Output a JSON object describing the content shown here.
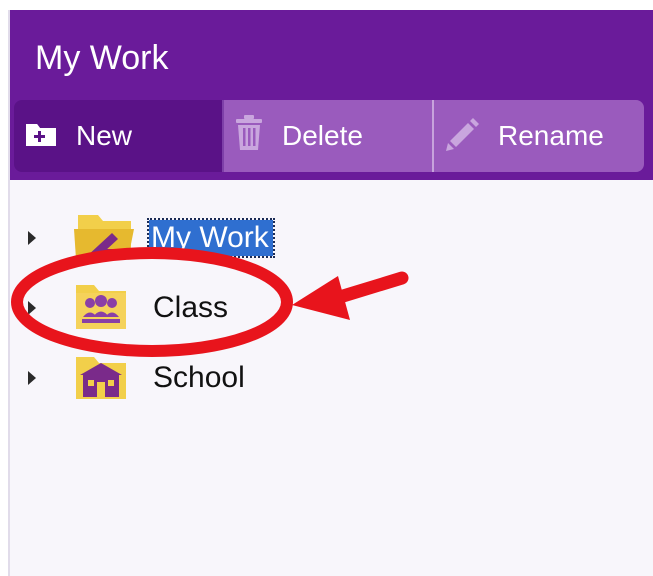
{
  "panel": {
    "title": "My Work"
  },
  "toolbar": {
    "new_label": "New",
    "delete_label": "Delete",
    "rename_label": "Rename"
  },
  "tree": {
    "items": [
      {
        "label": "My Work",
        "icon": "folder-pen-icon",
        "selected": true
      },
      {
        "label": "Class",
        "icon": "class-folder-icon",
        "selected": false
      },
      {
        "label": "School",
        "icon": "school-icon",
        "selected": false
      }
    ]
  },
  "colors": {
    "header": "#6a1b9a",
    "new_button": "#5a1287",
    "toolbar_button": "#9a5bbd",
    "selection": "#2f6fd0",
    "annotation": "#e8141c",
    "folder": "#f2cf4a"
  }
}
